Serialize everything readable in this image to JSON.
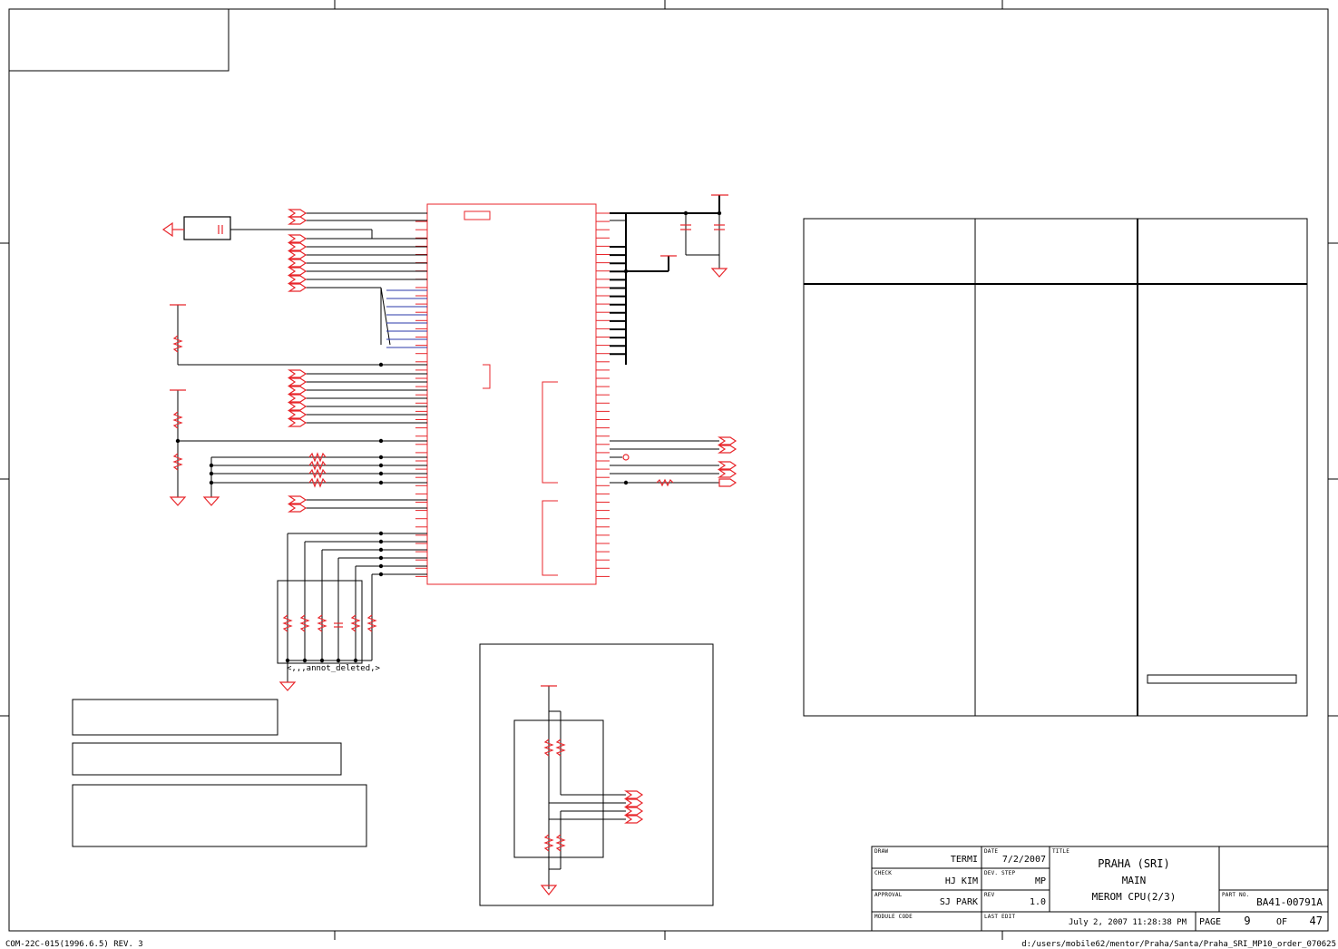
{
  "title_block": {
    "draw_label": "DRAW",
    "draw_value": "TERMI",
    "check_label": "CHECK",
    "check_value": "HJ KIM",
    "approval_label": "APPROVAL",
    "approval_value": "SJ PARK",
    "module_code_label": "MODULE CODE",
    "date_label": "DATE",
    "date_value": "7/2/2007",
    "dev_step_label": "DEV. STEP",
    "dev_step_value": "MP",
    "rev_label": "REV",
    "rev_value": "1.0",
    "last_edit_label": "LAST EDIT",
    "last_edit_value": "July 2, 2007  11:28:38 PM",
    "title_label": "TITLE",
    "title_line1": "PRAHA (SRI)",
    "title_line2": "MAIN",
    "title_line3": "MEROM CPU(2/3)",
    "part_no_label": "PART NO.",
    "part_no_value": "BA41-00791A",
    "page_label": "PAGE",
    "page_value": "9",
    "of_label": "OF",
    "of_value": "47"
  },
  "footer": {
    "form_code": "COM-22C-015(1996.6.5) REV. 3",
    "file_path": "d:/users/mobile62/mentor/Praha/Santa/Praha_SRI_MP10_order_070625"
  },
  "annotations": {
    "deleted_note": "<,,,annot_deleted,>"
  },
  "colors": {
    "schematic_red": "#e8262b",
    "wire_black": "#000000",
    "frame_black": "#000000",
    "bus_blue": "#2b3aa8"
  }
}
